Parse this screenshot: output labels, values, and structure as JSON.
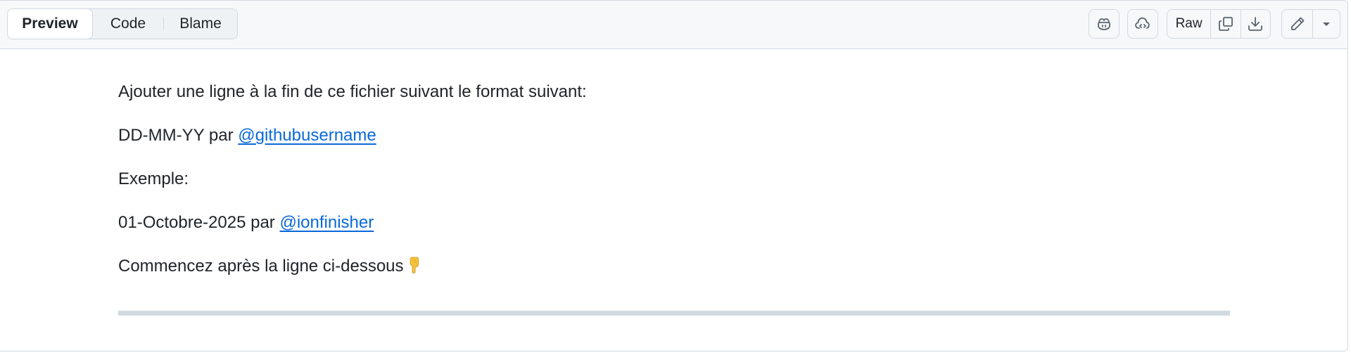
{
  "tabs": [
    {
      "label": "Preview",
      "selected": true
    },
    {
      "label": "Code",
      "selected": false
    },
    {
      "label": "Blame",
      "selected": false
    }
  ],
  "toolbar": {
    "copilot_icon": "copilot-icon",
    "codespaces_icon": "cloud-code-icon",
    "raw_label": "Raw",
    "copy_icon": "copy-icon",
    "download_icon": "download-icon",
    "edit_icon": "pencil-icon",
    "more_icon": "triangle-down-icon"
  },
  "content": {
    "line1": "Ajouter une ligne à la fin de ce fichier suivant le format suivant:",
    "line2_prefix": "DD-MM-YY par ",
    "line2_link": "@githubusername",
    "line3": "Exemple:",
    "line4_prefix": "01-Octobre-2025 par ",
    "line4_link": "@ionfinisher",
    "line5": "Commencez après la ligne ci-dessous"
  },
  "colors": {
    "link": "#0969da",
    "text": "#1f2328",
    "header_bg": "#f6f8fa",
    "border": "#d1d9e0"
  }
}
